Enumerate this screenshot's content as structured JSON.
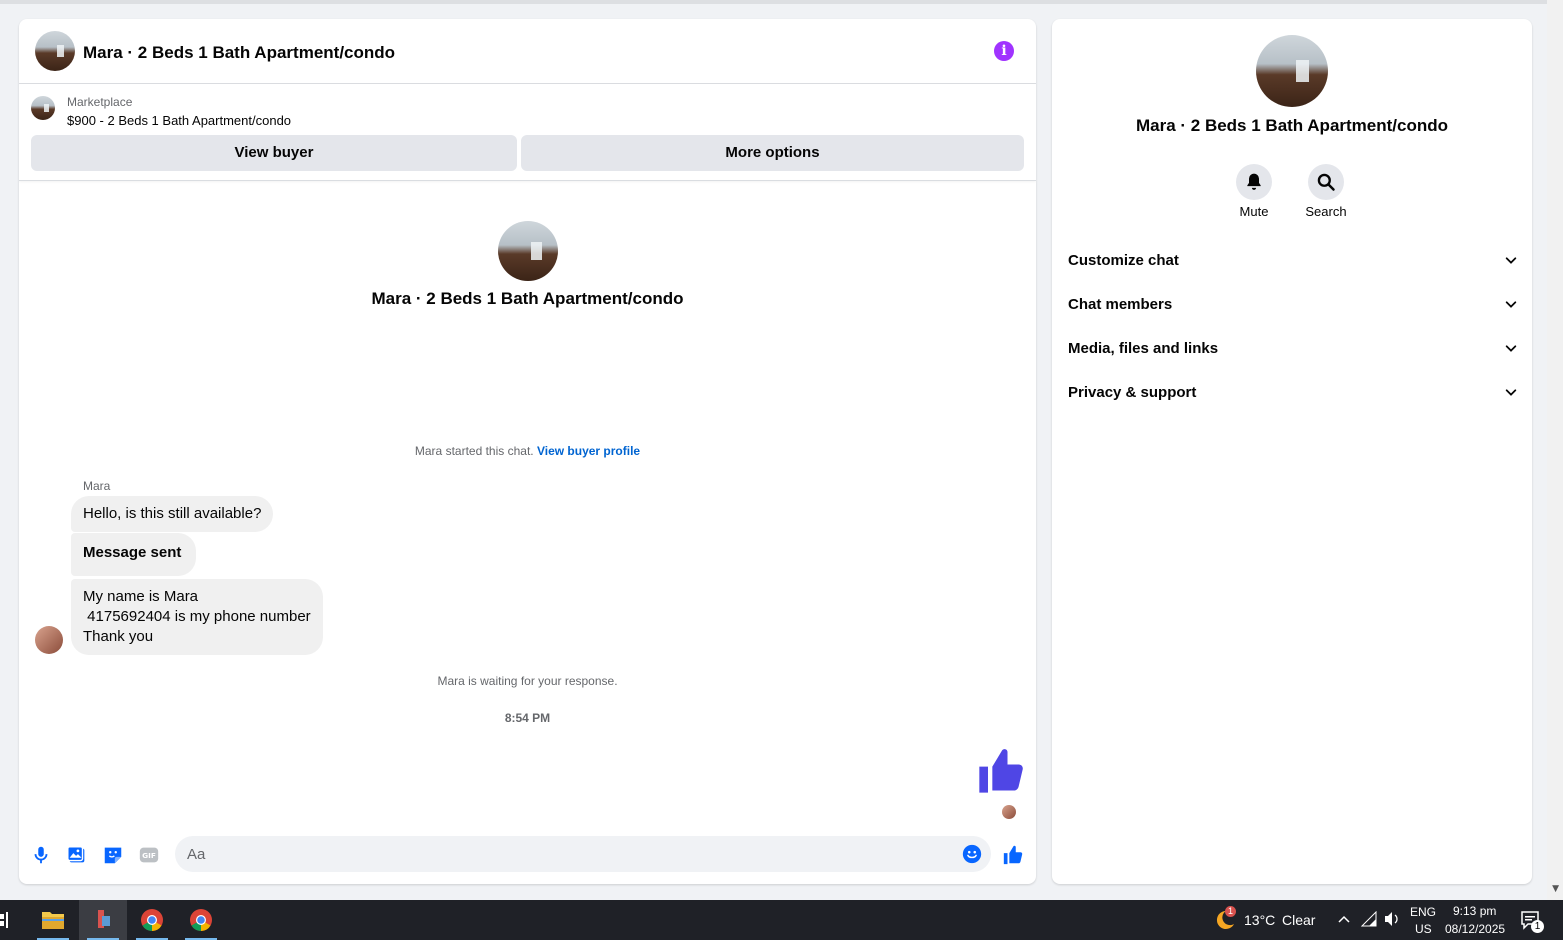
{
  "chat": {
    "title": "Mara · 2 Beds 1 Bath Apartment/condo",
    "listing": {
      "source": "Marketplace",
      "price_title": "$900 - 2 Beds 1 Bath Apartment/condo",
      "view_buyer_label": "View buyer",
      "more_options_label": "More options"
    },
    "center_title": "Mara · 2 Beds 1 Bath Apartment/condo",
    "started_text": "Mara started this chat.",
    "started_link": "View buyer profile",
    "sender": "Mara",
    "messages": [
      "Hello, is this still available?",
      "Message sent",
      "My name is Mara\n 4175692404 is my phone number\nThank you"
    ],
    "waiting_text": "Mara is waiting for your response.",
    "timestamp": "8:54 PM",
    "composer_placeholder": "Aa"
  },
  "info": {
    "title": "Mara · 2 Beds 1 Bath Apartment/condo",
    "actions": {
      "mute": "Mute",
      "search": "Search"
    },
    "sections": [
      "Customize chat",
      "Chat members",
      "Media, files and links",
      "Privacy & support"
    ]
  },
  "taskbar": {
    "weather_temp": "13°C",
    "weather_text": "Clear",
    "weather_badge": "1",
    "lang": "ENG",
    "region": "US",
    "time": "9:13 pm",
    "date": "08/12/2025",
    "notif_count": "1"
  },
  "colors": {
    "accent": "#0084ff",
    "like": "#4f46e5",
    "info": "#a033ff"
  },
  "icons": [
    "info-icon",
    "mic-icon",
    "image-icon",
    "sticker-icon",
    "gif-icon",
    "emoji-icon",
    "thumbs-up-icon",
    "bell-icon",
    "search-icon",
    "chevron-down-icon"
  ]
}
